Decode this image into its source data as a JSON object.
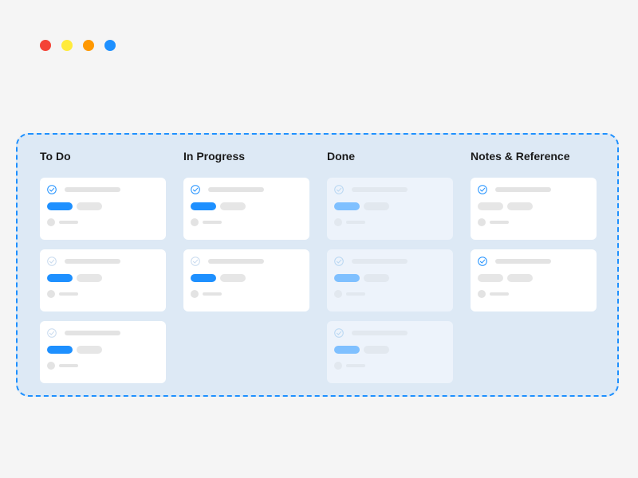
{
  "window": {
    "dots": [
      {
        "name": "close-dot",
        "color": "#f44336"
      },
      {
        "name": "minimize-dot",
        "color": "#ffeb3b"
      },
      {
        "name": "zoom-dot",
        "color": "#ff9800"
      },
      {
        "name": "extra-dot",
        "color": "#1e90ff"
      }
    ]
  },
  "board": {
    "border_color": "#1e90ff",
    "background": "#dde9f5",
    "columns": [
      {
        "id": "todo",
        "title": "To Do",
        "card_count": 3,
        "state": "active",
        "tag_color": "#1e90ff",
        "check_color": "#1e90ff"
      },
      {
        "id": "in-progress",
        "title": "In Progress",
        "card_count": 2,
        "state": "active",
        "tag_color": "#1e90ff",
        "check_color": "#1e90ff"
      },
      {
        "id": "done",
        "title": "Done",
        "card_count": 3,
        "state": "done",
        "tag_color": "#7fc0ff",
        "check_color": "#b9d7f2"
      },
      {
        "id": "notes",
        "title": "Notes & Reference",
        "card_count": 2,
        "state": "notes",
        "tag_color": "#e6e6e6",
        "check_color": "#1e90ff"
      }
    ]
  }
}
